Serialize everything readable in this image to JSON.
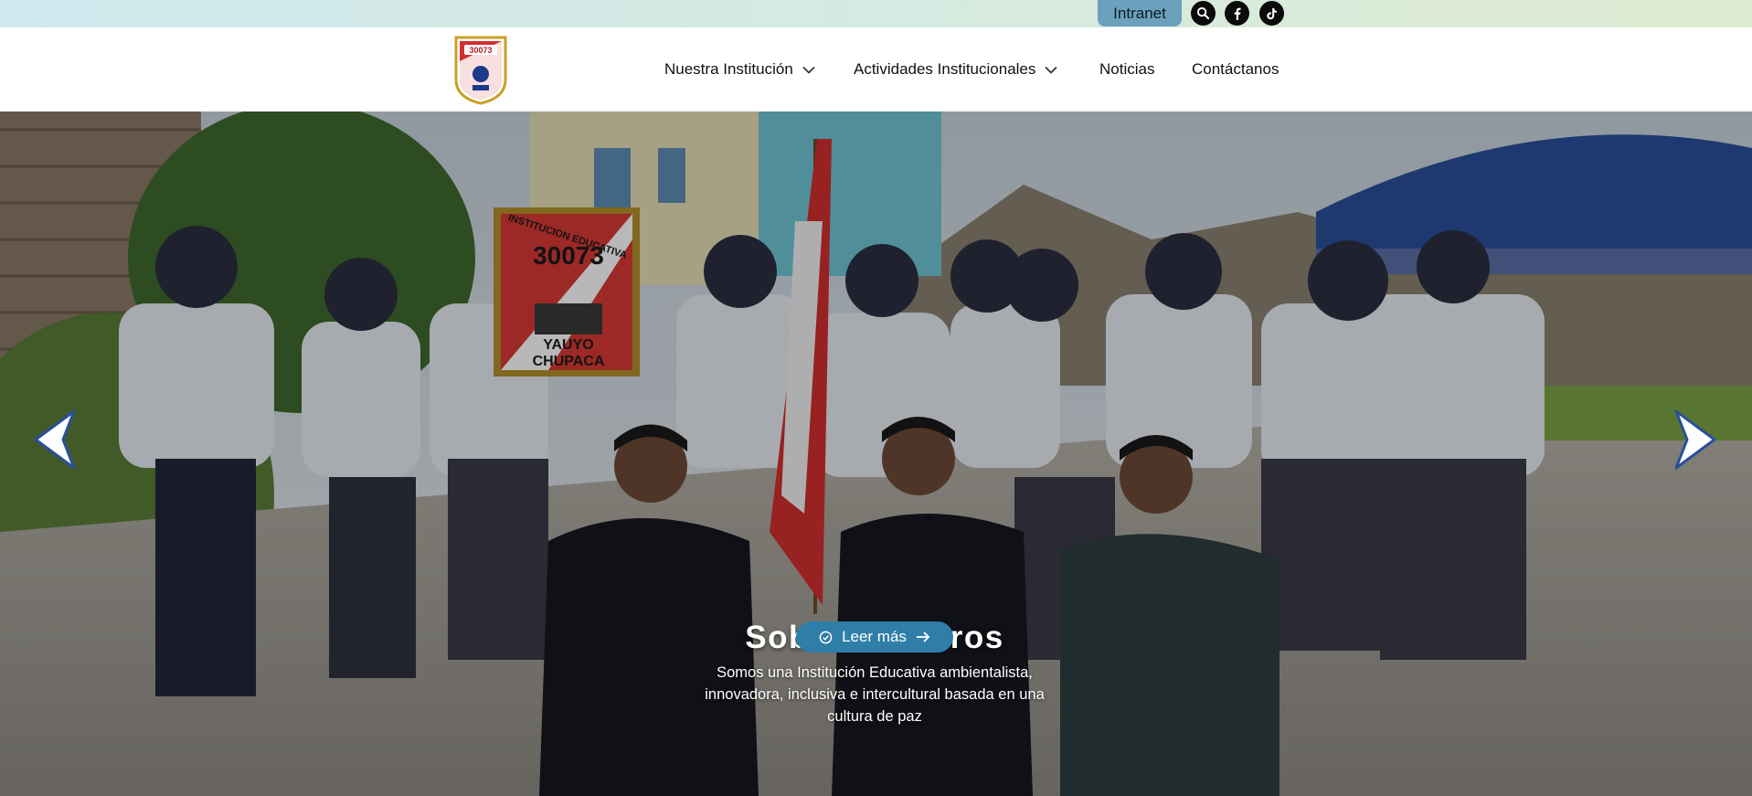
{
  "topbar": {
    "intranet_label": "Intranet",
    "icons": [
      "search-icon",
      "facebook-icon",
      "tiktok-icon"
    ]
  },
  "header": {
    "logo": {
      "alt": "Institución Educativa 30073 Yauyo Chupaca",
      "number": "30073"
    },
    "nav": [
      {
        "label": "Nuestra Institución",
        "has_dropdown": true
      },
      {
        "label": "Actividades Institucionales",
        "has_dropdown": true
      },
      {
        "label": "Noticias",
        "has_dropdown": false
      },
      {
        "label": "Contáctanos",
        "has_dropdown": false
      }
    ]
  },
  "hero": {
    "banner": {
      "line1": "INSTITUCION EDUCATIVA",
      "number": "30073",
      "line3": "YAUYO",
      "line4": "CHUPACA"
    },
    "title": "Sobre Nosotros",
    "description": "Somos una Institución Educativa ambientalista, innovadora, inclusiva e intercultural basada en una cultura de paz",
    "button_label": "Leer más",
    "colors": {
      "button": "#2f7ea8",
      "accent_red": "#d32f2f"
    }
  }
}
